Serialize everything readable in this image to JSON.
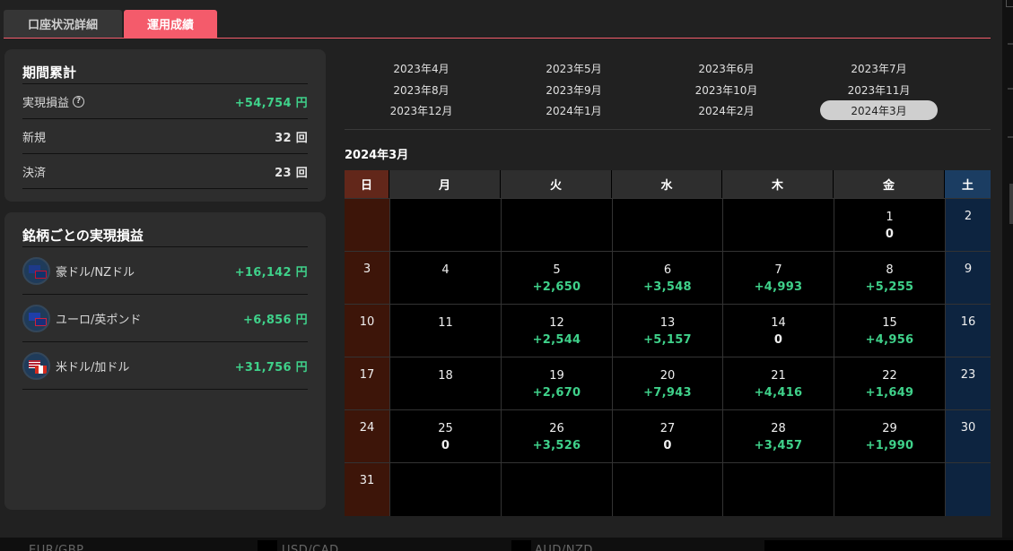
{
  "tabs": [
    {
      "label": "口座状況詳細",
      "active": false
    },
    {
      "label": "運用成績",
      "active": true
    }
  ],
  "summary": {
    "title": "期間累計",
    "rows": [
      {
        "label": "実現損益",
        "value": "+54,754 円",
        "help": true
      },
      {
        "label": "新規",
        "value": "32 回"
      },
      {
        "label": "決済",
        "value": "23 回"
      }
    ]
  },
  "symbols": {
    "title": "銘柄ごとの実現損益",
    "rows": [
      {
        "name": "豪ドル/NZドル",
        "value": "+16,142 円",
        "icon": "aud-nzd-flag-icon"
      },
      {
        "name": "ユーロ/英ポンド",
        "value": "+6,856 円",
        "icon": "eur-gbp-flag-icon"
      },
      {
        "name": "米ドル/加ドル",
        "value": "+31,756 円",
        "icon": "usd-cad-flag-icon"
      }
    ]
  },
  "months": [
    "2023年4月",
    "2023年5月",
    "2023年6月",
    "2023年7月",
    "2023年8月",
    "2023年9月",
    "2023年10月",
    "2023年11月",
    "2023年12月",
    "2024年1月",
    "2024年2月",
    "2024年3月"
  ],
  "selected_month": "2024年3月",
  "calendar": {
    "title": "2024年3月",
    "weekdays": [
      "日",
      "月",
      "火",
      "水",
      "木",
      "金",
      "土"
    ],
    "weeks": [
      [
        null,
        null,
        null,
        null,
        null,
        {
          "day": "1",
          "pl": "0"
        },
        {
          "day": "2",
          "pl": ""
        }
      ],
      [
        {
          "day": "3",
          "pl": ""
        },
        {
          "day": "4",
          "pl": ""
        },
        {
          "day": "5",
          "pl": "+2,650"
        },
        {
          "day": "6",
          "pl": "+3,548"
        },
        {
          "day": "7",
          "pl": "+4,993"
        },
        {
          "day": "8",
          "pl": "+5,255"
        },
        {
          "day": "9",
          "pl": ""
        }
      ],
      [
        {
          "day": "10",
          "pl": ""
        },
        {
          "day": "11",
          "pl": ""
        },
        {
          "day": "12",
          "pl": "+2,544"
        },
        {
          "day": "13",
          "pl": "+5,157"
        },
        {
          "day": "14",
          "pl": "0"
        },
        {
          "day": "15",
          "pl": "+4,956"
        },
        {
          "day": "16",
          "pl": ""
        }
      ],
      [
        {
          "day": "17",
          "pl": ""
        },
        {
          "day": "18",
          "pl": ""
        },
        {
          "day": "19",
          "pl": "+2,670"
        },
        {
          "day": "20",
          "pl": "+7,943"
        },
        {
          "day": "21",
          "pl": "+4,416"
        },
        {
          "day": "22",
          "pl": "+1,649"
        },
        {
          "day": "23",
          "pl": ""
        }
      ],
      [
        {
          "day": "24",
          "pl": ""
        },
        {
          "day": "25",
          "pl": "0"
        },
        {
          "day": "26",
          "pl": "+3,526"
        },
        {
          "day": "27",
          "pl": "0"
        },
        {
          "day": "28",
          "pl": "+3,457"
        },
        {
          "day": "29",
          "pl": "+1,990"
        },
        {
          "day": "30",
          "pl": ""
        }
      ],
      [
        {
          "day": "31",
          "pl": ""
        },
        null,
        null,
        null,
        null,
        null,
        null
      ]
    ]
  },
  "bottom_strip": [
    "EUR/GBP",
    "USD/CAD",
    "AUD/NZD"
  ],
  "colors": {
    "accent": "#f45b6b",
    "positive": "#3fd18a",
    "sunday": "#3d1509",
    "saturday": "#0d2440"
  }
}
